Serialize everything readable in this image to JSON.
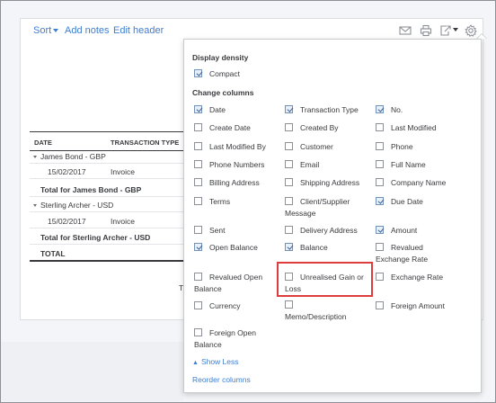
{
  "toolbar": {
    "sort_label": "Sort",
    "add_notes_label": "Add notes",
    "edit_header_label": "Edit header",
    "icons": [
      "mail-icon",
      "print-icon",
      "export-icon",
      "gear-icon"
    ]
  },
  "report_table": {
    "headers": [
      "DATE",
      "TRANSACTION TYPE"
    ],
    "rows": [
      {
        "kind": "group",
        "label": "James Bond - GBP"
      },
      {
        "kind": "row",
        "date": "15/02/2017",
        "type": "Invoice"
      },
      {
        "kind": "total",
        "label": "Total for James Bond - GBP"
      },
      {
        "kind": "group",
        "label": "Sterling Archer - USD"
      },
      {
        "kind": "row",
        "date": "15/02/2017",
        "type": "Invoice"
      },
      {
        "kind": "total",
        "label": "Total for Sterling Archer - USD"
      },
      {
        "kind": "grand",
        "label": "TOTAL"
      }
    ],
    "stray_char": "T"
  },
  "settings_popup": {
    "display_density_title": "Display density",
    "compact": {
      "label": "Compact",
      "checked": true
    },
    "change_columns_title": "Change columns",
    "columns": [
      {
        "label": "Date",
        "checked": true
      },
      {
        "label": "Transaction Type",
        "checked": true
      },
      {
        "label": "No.",
        "checked": true
      },
      {
        "label": "Create Date",
        "checked": false
      },
      {
        "label": "Created By",
        "checked": false
      },
      {
        "label": "Last Modified",
        "checked": false
      },
      {
        "label": "Last Modified By",
        "checked": false
      },
      {
        "label": "Customer",
        "checked": false
      },
      {
        "label": "Phone",
        "checked": false
      },
      {
        "label": "Phone Numbers",
        "checked": false
      },
      {
        "label": "Email",
        "checked": false
      },
      {
        "label": "Full Name",
        "checked": false
      },
      {
        "label": "Billing Address",
        "checked": false
      },
      {
        "label": "Shipping Address",
        "checked": false
      },
      {
        "label": "Company Name",
        "checked": false
      },
      {
        "label": "Terms",
        "checked": false
      },
      {
        "label": "Client/Supplier Message",
        "checked": false
      },
      {
        "label": "Due Date",
        "checked": true
      },
      {
        "label": "Sent",
        "checked": false
      },
      {
        "label": "Delivery Address",
        "checked": false
      },
      {
        "label": "Amount",
        "checked": true
      },
      {
        "label": "Open Balance",
        "checked": true
      },
      {
        "label": "Balance",
        "checked": true
      },
      {
        "label": "Revalued Exchange Rate",
        "checked": false
      },
      {
        "label": "Revalued Open Balance",
        "checked": false
      },
      {
        "label": "Unrealised Gain or Loss",
        "checked": false
      },
      {
        "label": "Exchange Rate",
        "checked": false
      },
      {
        "label": "Currency",
        "checked": false
      },
      {
        "label": "Memo/Description",
        "checked": false
      },
      {
        "label": "Foreign Amount",
        "checked": false
      },
      {
        "label": "Foreign Open Balance",
        "checked": false
      }
    ],
    "show_less_label": "Show Less",
    "reorder_columns_label": "Reorder columns",
    "highlight_color": "#dd3d3d",
    "link_color": "#3e7ed0"
  }
}
